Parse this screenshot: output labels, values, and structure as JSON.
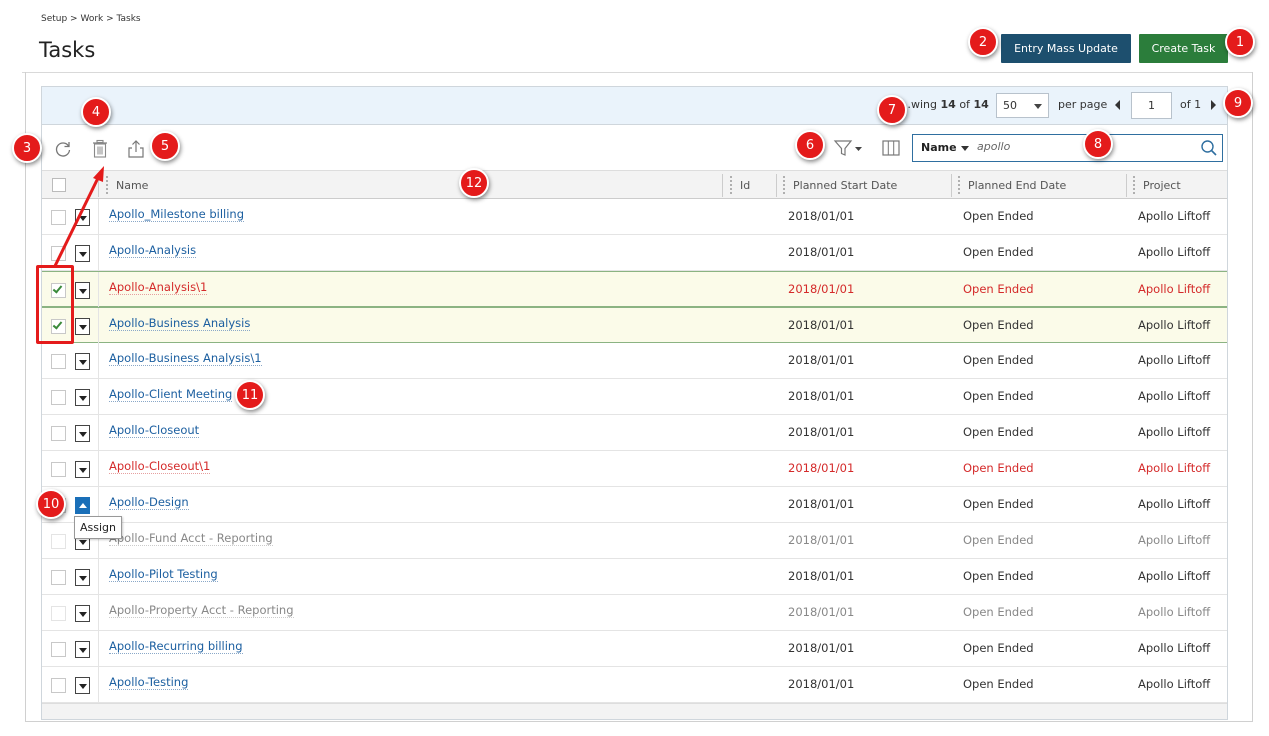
{
  "breadcrumb": "Setup > Work > Tasks",
  "page_title": "Tasks",
  "buttons": {
    "entry_mass_update": "Entry Mass Update",
    "create_task": "Create Task"
  },
  "pager": {
    "showing_prefix": "…wing",
    "shown": "14",
    "of_word": "of",
    "total": "14",
    "per_page_value": "50",
    "per_page_label": "per page",
    "current_page": "1",
    "of_pages": "of 1"
  },
  "search": {
    "field": "Name",
    "value": "apollo"
  },
  "columns": [
    "Name",
    "Id",
    "Planned Start Date",
    "Planned End Date",
    "Project"
  ],
  "rows": [
    {
      "name": "Apollo_Milestone billing",
      "start": "2018/01/01",
      "end": "Open Ended",
      "project": "Apollo Liftoff"
    },
    {
      "name": "Apollo-Analysis",
      "start": "2018/01/01",
      "end": "Open Ended",
      "project": "Apollo Liftoff"
    },
    {
      "name": "Apollo-Analysis\\1",
      "start": "2018/01/01",
      "end": "Open Ended",
      "project": "Apollo Liftoff"
    },
    {
      "name": "Apollo-Business Analysis",
      "start": "2018/01/01",
      "end": "Open Ended",
      "project": "Apollo Liftoff"
    },
    {
      "name": "Apollo-Business Analysis\\1",
      "start": "2018/01/01",
      "end": "Open Ended",
      "project": "Apollo Liftoff"
    },
    {
      "name": "Apollo-Client Meeting",
      "start": "2018/01/01",
      "end": "Open Ended",
      "project": "Apollo Liftoff"
    },
    {
      "name": "Apollo-Closeout",
      "start": "2018/01/01",
      "end": "Open Ended",
      "project": "Apollo Liftoff"
    },
    {
      "name": "Apollo-Closeout\\1",
      "start": "2018/01/01",
      "end": "Open Ended",
      "project": "Apollo Liftoff"
    },
    {
      "name": "Apollo-Design",
      "start": "2018/01/01",
      "end": "Open Ended",
      "project": "Apollo Liftoff"
    },
    {
      "name": "Apollo-Fund Acct - Reporting",
      "start": "2018/01/01",
      "end": "Open Ended",
      "project": "Apollo Liftoff"
    },
    {
      "name": "Apollo-Pilot Testing",
      "start": "2018/01/01",
      "end": "Open Ended",
      "project": "Apollo Liftoff"
    },
    {
      "name": "Apollo-Property Acct - Reporting",
      "start": "2018/01/01",
      "end": "Open Ended",
      "project": "Apollo Liftoff"
    },
    {
      "name": "Apollo-Recurring billing",
      "start": "2018/01/01",
      "end": "Open Ended",
      "project": "Apollo Liftoff"
    },
    {
      "name": "Apollo-Testing",
      "start": "2018/01/01",
      "end": "Open Ended",
      "project": "Apollo Liftoff"
    }
  ],
  "tooltip": "Assign",
  "badges": [
    "1",
    "2",
    "3",
    "4",
    "5",
    "6",
    "7",
    "8",
    "9",
    "10",
    "11",
    "12"
  ],
  "colors": {
    "primary_blue": "#1d4f6e",
    "create_green": "#2b7d3b",
    "link_blue": "#1c5fa0",
    "error_red": "#d42a2a",
    "annotation_red": "#e41b1b"
  }
}
